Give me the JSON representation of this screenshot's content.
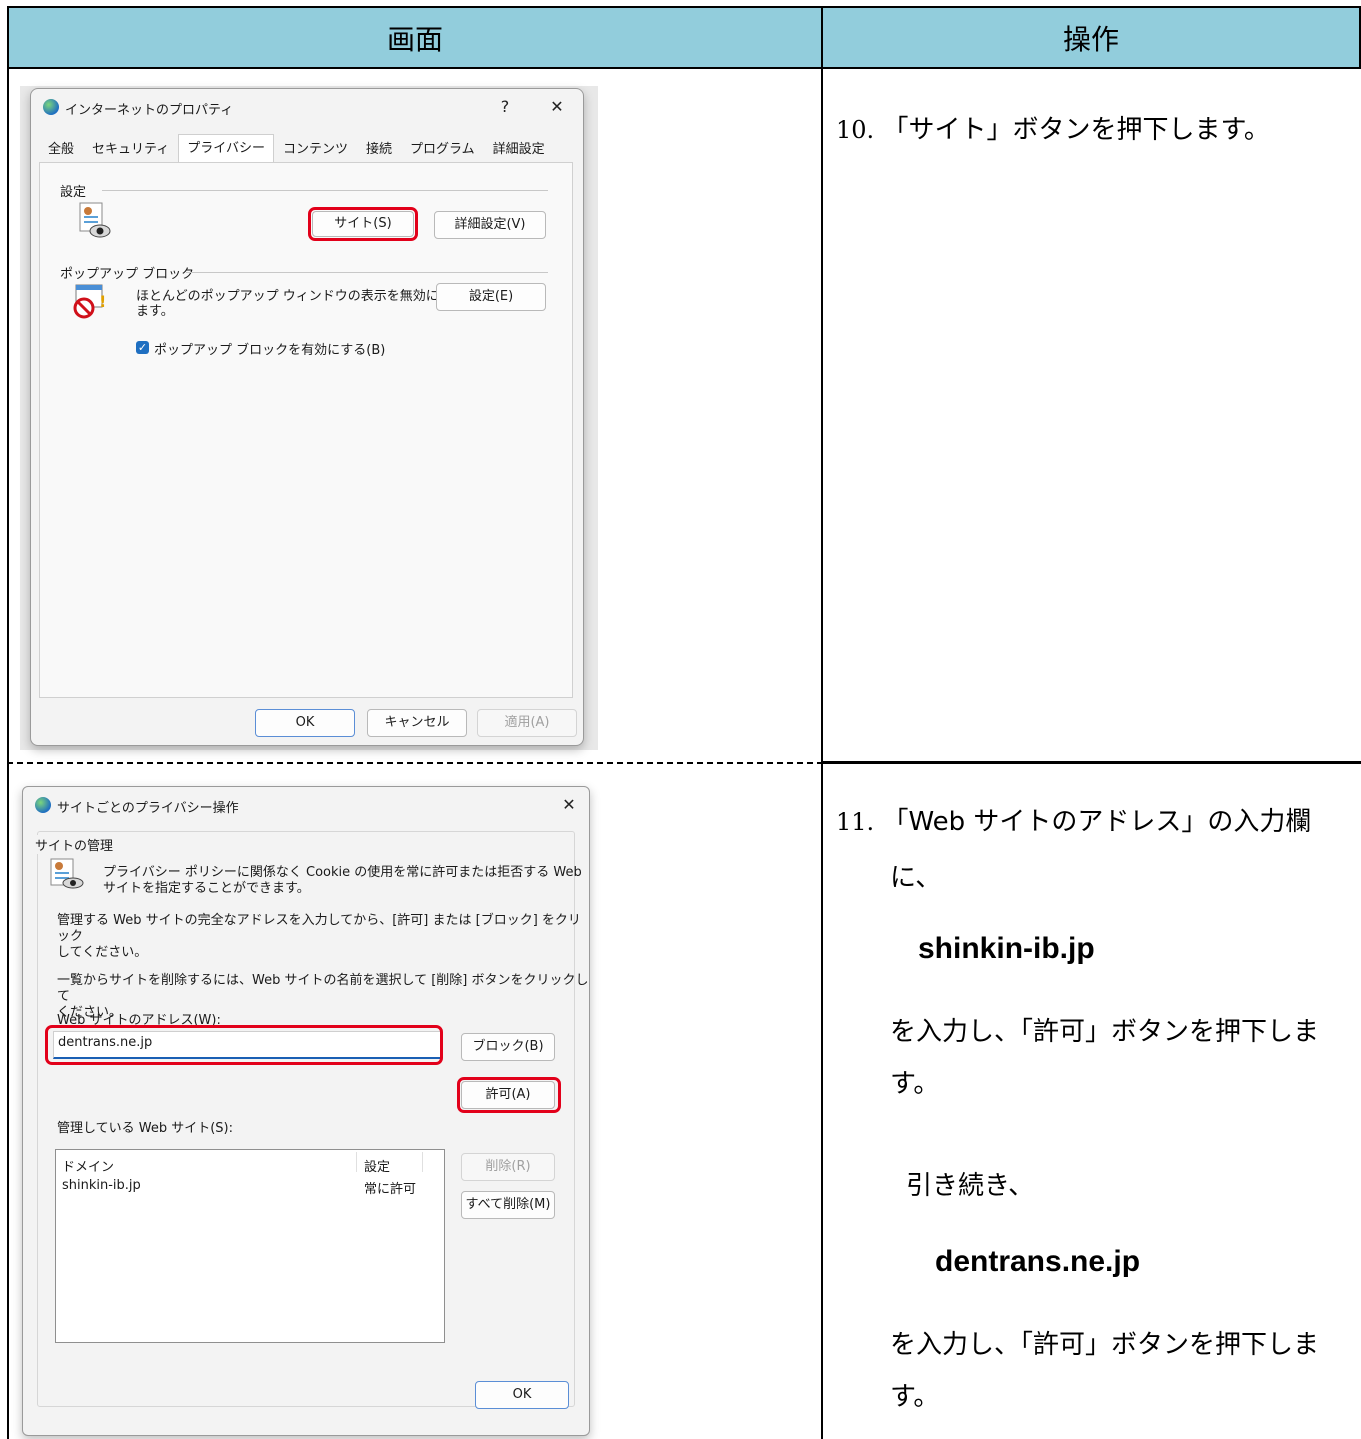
{
  "table": {
    "header_screen": "画面",
    "header_operation": "操作"
  },
  "step10": {
    "number": "10.",
    "text": "「サイト」ボタンを押下します。"
  },
  "step11": {
    "number": "11.",
    "line1": "「Web サイトのアドレス」の入力欄",
    "line2": "に、",
    "url1": "shinkin-ib.jp",
    "line3": "を入力し、「許可」ボタンを押下しま",
    "line4": "す。",
    "line5": "引き続き、",
    "url2": "dentrans.ne.jp",
    "line6": "を入力し、「許可」ボタンを押下しま",
    "line7": "す。"
  },
  "dialog1": {
    "title": "インターネットのプロパティ",
    "help_glyph": "?",
    "close_glyph": "✕",
    "tabs": [
      "全般",
      "セキュリティ",
      "プライバシー",
      "コンテンツ",
      "接続",
      "プログラム",
      "詳細設定"
    ],
    "settings_group": "設定",
    "sites_button": "サイト(S)",
    "advanced_button": "詳細設定(V)",
    "popup_group": "ポップアップ ブロック",
    "popup_desc_line1": "ほとんどのポップアップ ウィンドウの表示を無効にし",
    "popup_desc_line2": "ます。",
    "popup_settings_button": "設定(E)",
    "popup_checkbox_label": "ポップアップ ブロックを有効にする(B)",
    "ok_button": "OK",
    "cancel_button": "キャンセル",
    "apply_button": "適用(A)"
  },
  "dialog2": {
    "title": "サイトごとのプライバシー操作",
    "close_glyph": "✕",
    "group": "サイトの管理",
    "desc_line1": "プライバシー ポリシーに関係なく Cookie の使用を常に許可または拒否する Web",
    "desc_line2": "サイトを指定することができます。",
    "instr1_line1": "管理する Web サイトの完全なアドレスを入力してから、[許可] または [ブロック] をクリック",
    "instr1_line2": "してください。",
    "instr2_line1": "一覧からサイトを削除するには、Web サイトの名前を選択して [削除] ボタンをクリックして",
    "instr2_line2": "ください。",
    "address_label": "Web サイトのアドレス(W):",
    "address_value": "dentrans.ne.jp",
    "block_button": "ブロック(B)",
    "allow_button": "許可(A)",
    "managed_label": "管理している Web サイト(S):",
    "col_domain": "ドメイン",
    "col_setting": "設定",
    "rows": [
      {
        "domain": "shinkin-ib.jp",
        "setting": "常に許可"
      }
    ],
    "remove_button": "削除(R)",
    "remove_all_button": "すべて削除(M)",
    "ok_button": "OK"
  },
  "colors": {
    "header_bg": "#92cddc",
    "highlight": "#e2001a",
    "input_accent": "#1a5fb4"
  }
}
